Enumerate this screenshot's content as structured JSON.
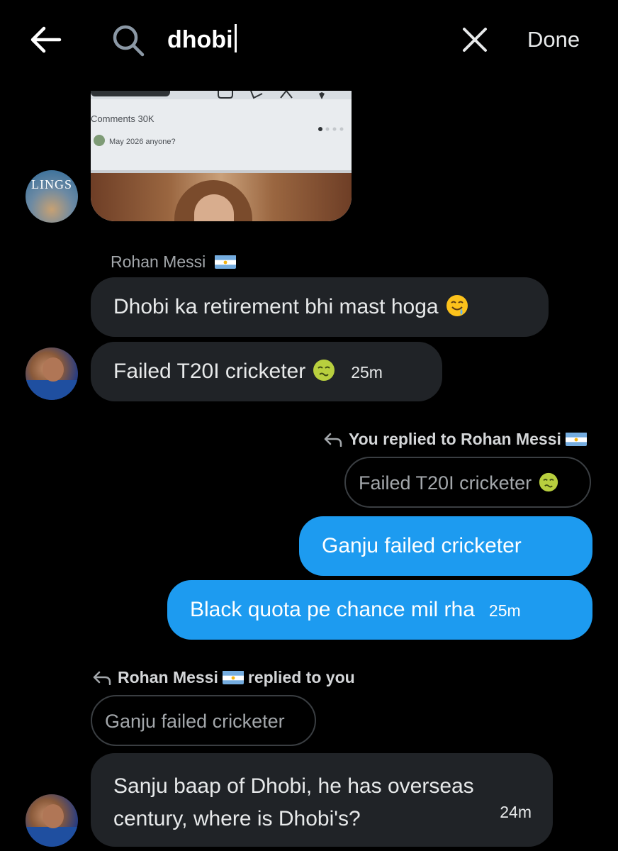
{
  "header": {
    "search_query": "dhobi",
    "done_label": "Done"
  },
  "media_card": {
    "comments_label": "Comments 30K",
    "reply_text": "May 2026 anyone?"
  },
  "avatar_text": "LINGS",
  "messages": [
    {
      "sender": "Rohan Messi",
      "text": "Dhobi ka retirement bhi mast hoga"
    },
    {
      "text": "Failed T20I cricketer",
      "time": "25m"
    },
    {
      "reply_context": "You replied to Rohan Messi",
      "quoted_text": "Failed T20I cricketer",
      "text": "Ganju failed cricketer"
    },
    {
      "text": "Black quota pe chance mil rha",
      "time": "25m"
    },
    {
      "reply_context_name": "Rohan Messi",
      "reply_context_suffix": "replied to you",
      "quoted_text": "Ganju failed cricketer",
      "text": "Sanju baap of Dhobi, he has overseas century, where is Dhobi's?",
      "time": "24m"
    }
  ],
  "colors": {
    "background": "#000000",
    "incoming_bubble": "#202327",
    "outgoing_bubble": "#1d9bf0",
    "secondary_text": "#a3a7ab"
  },
  "icons": [
    "back-arrow-icon",
    "search-icon",
    "close-icon",
    "argentina-flag-icon",
    "drooling-face-icon",
    "nauseated-face-icon",
    "reply-arrow-icon"
  ]
}
